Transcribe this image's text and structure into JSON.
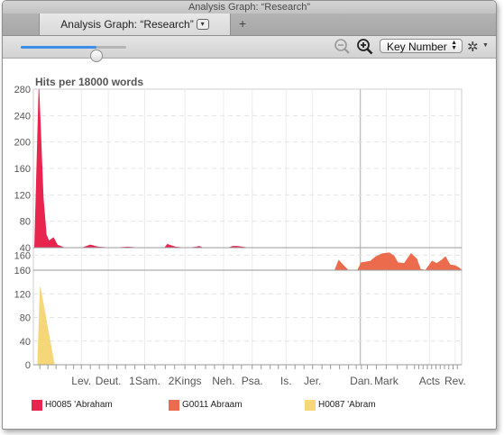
{
  "window": {
    "title": "Analysis Graph: “Research”",
    "tab_label": "Analysis Graph: “Research”",
    "add_tab_icon": "plus-icon"
  },
  "toolbar": {
    "slider_value": 0.72,
    "zoom_out_icon": "zoom-out-icon",
    "zoom_in_icon": "zoom-in-icon",
    "select_value": "Key Number",
    "settings_icon": "gear-icon"
  },
  "chart_data": {
    "type": "area",
    "ylabel": "Hits per 18000 words",
    "x_ticks": [
      "Lev.",
      "Deut.",
      "1Sam.",
      "2Kings",
      "Neh.",
      "Psa.",
      "Is.",
      "Jer.",
      "Dan.",
      "Mark",
      "Acts",
      "Rev."
    ],
    "colors": {
      "H0085": "#e8254e",
      "G0011": "#ec6b4d",
      "H0087": "#f5d77a"
    },
    "panels": [
      {
        "series": "H0085 'Abraham",
        "color": "#e8254e",
        "y_ticks": [
          "280",
          "240",
          "200",
          "160",
          "120",
          "80",
          "40"
        ],
        "ylim": [
          40,
          280
        ],
        "points": [
          [
            0.0,
            40
          ],
          [
            0.3,
            40
          ],
          [
            1.3,
            280
          ],
          [
            2.3,
            115
          ],
          [
            3.0,
            60
          ],
          [
            3.6,
            50
          ],
          [
            4.7,
            55
          ],
          [
            5.6,
            44
          ],
          [
            6.4,
            42
          ],
          [
            7.2,
            40
          ],
          [
            9.0,
            40
          ],
          [
            11.5,
            40
          ],
          [
            13.3,
            44
          ],
          [
            15.1,
            41
          ],
          [
            17.4,
            40
          ],
          [
            19.7,
            40
          ],
          [
            22.0,
            41
          ],
          [
            24.2,
            40
          ],
          [
            28.8,
            40
          ],
          [
            30.7,
            40
          ],
          [
            31.3,
            45
          ],
          [
            32.2,
            43
          ],
          [
            33.2,
            41
          ],
          [
            34.8,
            40
          ],
          [
            36.8,
            40
          ],
          [
            38.1,
            41
          ],
          [
            38.7,
            42
          ],
          [
            39.5,
            40
          ],
          [
            40.7,
            40
          ],
          [
            42.1,
            40
          ],
          [
            45.7,
            40
          ],
          [
            46.6,
            42
          ],
          [
            47.5,
            42
          ],
          [
            48.8,
            41
          ],
          [
            49.9,
            40
          ],
          [
            51.7,
            40
          ],
          [
            57.0,
            40
          ],
          [
            70.4,
            40
          ],
          [
            100,
            40
          ]
        ]
      },
      {
        "series": "G0011 Abraam",
        "color": "#ec6b4d",
        "y_ticks": [
          "160"
        ],
        "ylim": [
          140,
          170
        ],
        "points": [
          [
            0,
            140
          ],
          [
            70.4,
            140
          ],
          [
            71.3,
            153
          ],
          [
            72.6,
            145
          ],
          [
            73.5,
            140
          ],
          [
            75.7,
            140
          ],
          [
            76.6,
            150
          ],
          [
            77.7,
            151
          ],
          [
            78.7,
            152
          ],
          [
            80.0,
            158
          ],
          [
            81.5,
            162
          ],
          [
            83.1,
            163
          ],
          [
            84.2,
            159
          ],
          [
            85.1,
            150
          ],
          [
            86.6,
            149
          ],
          [
            88.2,
            162
          ],
          [
            89.5,
            155
          ],
          [
            90.4,
            141
          ],
          [
            91.6,
            139
          ],
          [
            93.1,
            152
          ],
          [
            94.2,
            149
          ],
          [
            95.5,
            154
          ],
          [
            96.2,
            158
          ],
          [
            97.3,
            147
          ],
          [
            98.5,
            146
          ],
          [
            99.4,
            143
          ],
          [
            100,
            140
          ]
        ]
      },
      {
        "series": "H0087 'Abram",
        "color": "#f5d77a",
        "y_ticks": [
          "160",
          "120",
          "80",
          "40",
          "0"
        ],
        "ylim": [
          0,
          160
        ],
        "points": [
          [
            0,
            0
          ],
          [
            1.0,
            0
          ],
          [
            1.6,
            131
          ],
          [
            4.9,
            0
          ],
          [
            100,
            0
          ]
        ]
      }
    ],
    "legend": [
      {
        "label": "H0085 'Abraham",
        "color": "#e8254e"
      },
      {
        "label": "G0011 Abraam",
        "color": "#ec6b4d"
      },
      {
        "label": "H0087 'Abram",
        "color": "#f5d77a"
      }
    ],
    "legend_position": "bottom",
    "grid": true
  }
}
